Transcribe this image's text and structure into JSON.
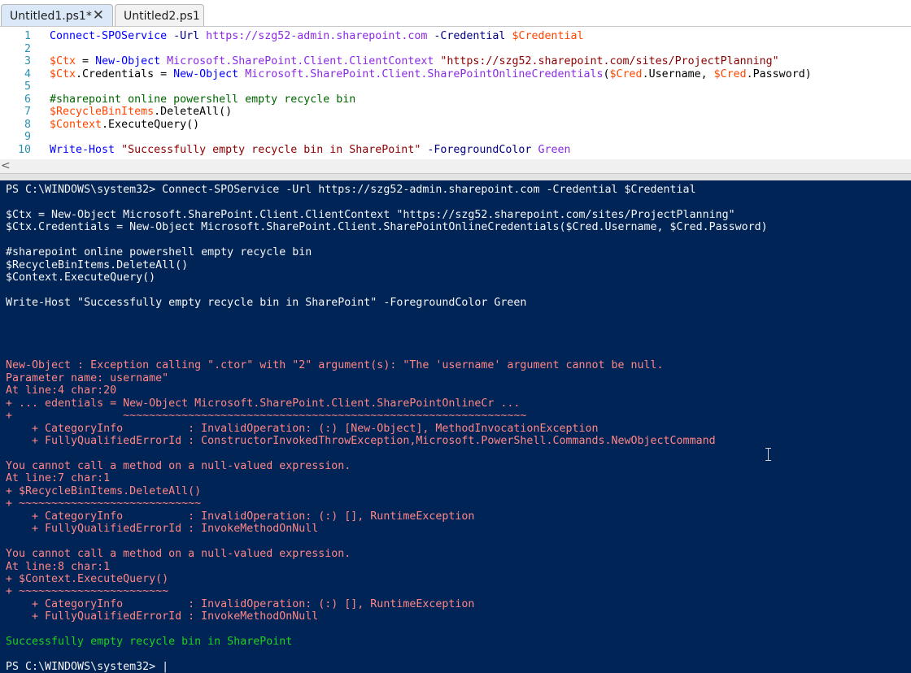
{
  "tabs": [
    {
      "label": "Untitled1.ps1*",
      "active": true,
      "close_icon": "close-icon"
    },
    {
      "label": "Untitled2.ps1",
      "active": false
    }
  ],
  "editor": {
    "lines": [
      {
        "num": "1",
        "segments": [
          {
            "t": "Connect-SPOService",
            "c": "cmd"
          },
          {
            "t": " ",
            "c": "ptx"
          },
          {
            "t": "-Url",
            "c": "param"
          },
          {
            "t": " ",
            "c": "ptx"
          },
          {
            "t": "https://szg52-admin.sharepoint.com",
            "c": "arg"
          },
          {
            "t": " ",
            "c": "ptx"
          },
          {
            "t": "-Credential",
            "c": "param"
          },
          {
            "t": " ",
            "c": "ptx"
          },
          {
            "t": "$Credential",
            "c": "var"
          }
        ]
      },
      {
        "num": "2",
        "segments": []
      },
      {
        "num": "3",
        "segments": [
          {
            "t": "$Ctx",
            "c": "var"
          },
          {
            "t": " = ",
            "c": "ptx"
          },
          {
            "t": "New-Object",
            "c": "cmd"
          },
          {
            "t": " ",
            "c": "ptx"
          },
          {
            "t": "Microsoft.SharePoint.Client.ClientContext",
            "c": "arg"
          },
          {
            "t": " ",
            "c": "ptx"
          },
          {
            "t": "\"https://szg52.sharepoint.com/sites/ProjectPlanning\"",
            "c": "str"
          }
        ]
      },
      {
        "num": "4",
        "segments": [
          {
            "t": "$Ctx",
            "c": "var"
          },
          {
            "t": ".Credentials = ",
            "c": "ptx"
          },
          {
            "t": "New-Object",
            "c": "cmd"
          },
          {
            "t": " ",
            "c": "ptx"
          },
          {
            "t": "Microsoft.SharePoint.Client.SharePointOnlineCredentials",
            "c": "arg"
          },
          {
            "t": "(",
            "c": "ptx"
          },
          {
            "t": "$Cred",
            "c": "var"
          },
          {
            "t": ".Username, ",
            "c": "ptx"
          },
          {
            "t": "$Cred",
            "c": "var"
          },
          {
            "t": ".Password)",
            "c": "ptx"
          }
        ]
      },
      {
        "num": "5",
        "segments": []
      },
      {
        "num": "6",
        "segments": [
          {
            "t": "#sharepoint online powershell empty recycle bin",
            "c": "cmt"
          }
        ]
      },
      {
        "num": "7",
        "segments": [
          {
            "t": "$RecycleBinItems",
            "c": "var"
          },
          {
            "t": ".DeleteAll()",
            "c": "ptx"
          }
        ]
      },
      {
        "num": "8",
        "segments": [
          {
            "t": "$Context",
            "c": "var"
          },
          {
            "t": ".ExecuteQuery()",
            "c": "ptx"
          }
        ]
      },
      {
        "num": "9",
        "segments": []
      },
      {
        "num": "10",
        "segments": [
          {
            "t": "Write-Host",
            "c": "cmd"
          },
          {
            "t": " ",
            "c": "ptx"
          },
          {
            "t": "\"Successfully empty recycle bin in SharePoint\"",
            "c": "str"
          },
          {
            "t": " ",
            "c": "ptx"
          },
          {
            "t": "-ForegroundColor",
            "c": "param"
          },
          {
            "t": " ",
            "c": "ptx"
          },
          {
            "t": "Green",
            "c": "arg"
          }
        ]
      }
    ]
  },
  "scrollbar": {
    "left_arrow": "<"
  },
  "console": {
    "lines": [
      {
        "text": "PS C:\\WINDOWS\\system32> Connect-SPOService -Url https://szg52-admin.sharepoint.com -Credential $Credential",
        "kind": "normal"
      },
      {
        "text": "",
        "kind": "normal"
      },
      {
        "text": "$Ctx = New-Object Microsoft.SharePoint.Client.ClientContext \"https://szg52.sharepoint.com/sites/ProjectPlanning\"",
        "kind": "normal"
      },
      {
        "text": "$Ctx.Credentials = New-Object Microsoft.SharePoint.Client.SharePointOnlineCredentials($Cred.Username, $Cred.Password)",
        "kind": "normal"
      },
      {
        "text": "",
        "kind": "normal"
      },
      {
        "text": "#sharepoint online powershell empty recycle bin",
        "kind": "normal"
      },
      {
        "text": "$RecycleBinItems.DeleteAll()",
        "kind": "normal"
      },
      {
        "text": "$Context.ExecuteQuery()",
        "kind": "normal"
      },
      {
        "text": "",
        "kind": "normal"
      },
      {
        "text": "Write-Host \"Successfully empty recycle bin in SharePoint\" -ForegroundColor Green",
        "kind": "normal"
      },
      {
        "text": "",
        "kind": "normal"
      },
      {
        "text": "",
        "kind": "normal"
      },
      {
        "text": "",
        "kind": "normal"
      },
      {
        "text": "",
        "kind": "normal"
      },
      {
        "text": "New-Object : Exception calling \".ctor\" with \"2\" argument(s): \"The 'username' argument cannot be null.",
        "kind": "err"
      },
      {
        "text": "Parameter name: username\"",
        "kind": "err"
      },
      {
        "text": "At line:4 char:20",
        "kind": "err"
      },
      {
        "text": "+ ... edentials = New-Object Microsoft.SharePoint.Client.SharePointOnlineCr ...",
        "kind": "err"
      },
      {
        "text": "+                 ~~~~~~~~~~~~~~~~~~~~~~~~~~~~~~~~~~~~~~~~~~~~~~~~~~~~~~~~~~~~~~",
        "kind": "err"
      },
      {
        "text": "    + CategoryInfo          : InvalidOperation: (:) [New-Object], MethodInvocationException",
        "kind": "err"
      },
      {
        "text": "    + FullyQualifiedErrorId : ConstructorInvokedThrowException,Microsoft.PowerShell.Commands.NewObjectCommand",
        "kind": "err"
      },
      {
        "text": "",
        "kind": "err"
      },
      {
        "text": "You cannot call a method on a null-valued expression.",
        "kind": "err"
      },
      {
        "text": "At line:7 char:1",
        "kind": "err"
      },
      {
        "text": "+ $RecycleBinItems.DeleteAll()",
        "kind": "err"
      },
      {
        "text": "+ ~~~~~~~~~~~~~~~~~~~~~~~~~~~~",
        "kind": "err"
      },
      {
        "text": "    + CategoryInfo          : InvalidOperation: (:) [], RuntimeException",
        "kind": "err"
      },
      {
        "text": "    + FullyQualifiedErrorId : InvokeMethodOnNull",
        "kind": "err"
      },
      {
        "text": "",
        "kind": "err"
      },
      {
        "text": "You cannot call a method on a null-valued expression.",
        "kind": "err"
      },
      {
        "text": "At line:8 char:1",
        "kind": "err"
      },
      {
        "text": "+ $Context.ExecuteQuery()",
        "kind": "err"
      },
      {
        "text": "+ ~~~~~~~~~~~~~~~~~~~~~~~",
        "kind": "err"
      },
      {
        "text": "    + CategoryInfo          : InvalidOperation: (:) [], RuntimeException",
        "kind": "err"
      },
      {
        "text": "    + FullyQualifiedErrorId : InvokeMethodOnNull",
        "kind": "err"
      },
      {
        "text": "",
        "kind": "err"
      },
      {
        "text": "Successfully empty recycle bin in SharePoint",
        "kind": "ok"
      },
      {
        "text": "",
        "kind": "normal"
      },
      {
        "text": "PS C:\\WINDOWS\\system32> |",
        "kind": "normal"
      }
    ]
  },
  "colors": {
    "console_bg": "#012456",
    "console_text": "#f5f5f5",
    "error_text": "#ff8686",
    "success_text": "#1fd01f"
  }
}
